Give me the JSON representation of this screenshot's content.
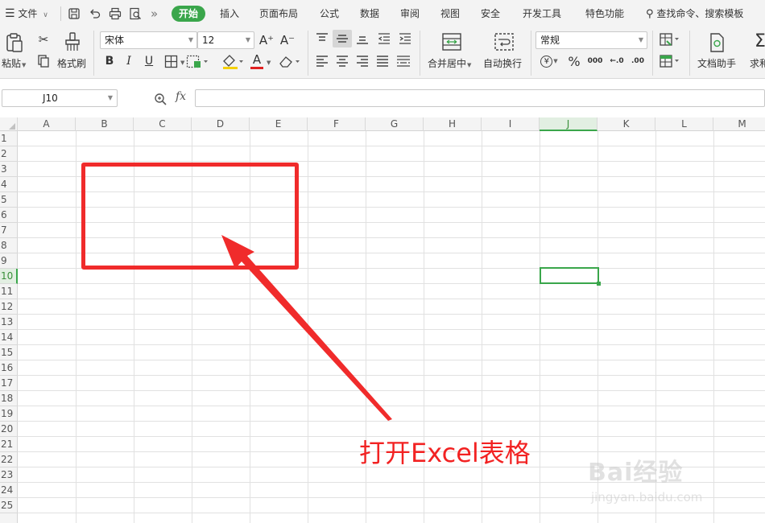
{
  "menubar": {
    "file_label": "文件",
    "overflow_glyph": "»",
    "tabs": [
      "开始",
      "插入",
      "页面布局",
      "公式",
      "数据",
      "审阅",
      "视图",
      "安全",
      "开发工具",
      "特色功能"
    ],
    "active_tab": "开始",
    "search_label": "查找命令、搜索模板"
  },
  "ribbon": {
    "paste_label": "粘贴",
    "format_painter_label": "格式刷",
    "font_name": "宋体",
    "font_size": "12",
    "grow_font_glyph": "A⁺",
    "shrink_font_glyph": "A⁻",
    "bold_glyph": "B",
    "italic_glyph": "I",
    "underline_glyph": "U",
    "font_color_glyph": "A",
    "merge_center_label": "合并居中",
    "wrap_text_label": "自动换行",
    "number_format": "常规",
    "currency_glyph": "¥",
    "percent_glyph": "%",
    "thousands_glyph": "000",
    "inc_decimal_glyph": "←.0",
    "dec_decimal_glyph": ".00",
    "doc_assistant_label": "文档助手",
    "sum_label": "求和",
    "accent_color": "#3aa64b",
    "font_color_bar": "#e02020",
    "fill_color_bar": "#f5d000"
  },
  "formula_bar": {
    "name_box": "J10",
    "fx_label": "fx",
    "formula": ""
  },
  "sheet": {
    "columns": [
      "A",
      "B",
      "C",
      "D",
      "E",
      "F",
      "G",
      "H",
      "I",
      "J",
      "K",
      "L",
      "M"
    ],
    "rows": [
      "1",
      "2",
      "3",
      "4",
      "5",
      "6",
      "7",
      "8",
      "9",
      "10",
      "11",
      "12",
      "13",
      "14",
      "15",
      "16",
      "17",
      "18",
      "19",
      "20",
      "21",
      "22",
      "23",
      "24",
      "25"
    ],
    "active_cell": "J10",
    "active_column": "J",
    "active_row": "10",
    "grid_color": "#e1e1e1",
    "selection_color": "#3aa64b"
  },
  "annotation": {
    "text": "打开Excel表格",
    "color": "#f02b2b"
  },
  "watermark": {
    "line1": "Bai经验",
    "line2": "jingyan.baidu.com"
  }
}
